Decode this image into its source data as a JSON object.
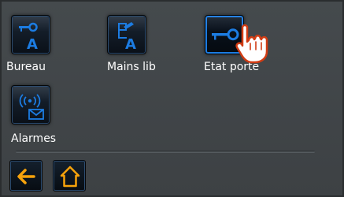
{
  "menu": {
    "items": [
      {
        "label": "Bureau",
        "icon": "key-a-icon"
      },
      {
        "label": "Mains lib",
        "icon": "handsfree-a-icon"
      },
      {
        "label": "Etat porte",
        "icon": "door-key-icon"
      },
      {
        "label": "Alarmes",
        "icon": "alarm-envelope-icon"
      }
    ]
  },
  "nav": {
    "back_icon": "arrow-left-icon",
    "home_icon": "home-icon"
  },
  "colors": {
    "accent_blue": "#1c7ce2",
    "nav_orange": "#f6a20b",
    "background": "#3f4346"
  }
}
